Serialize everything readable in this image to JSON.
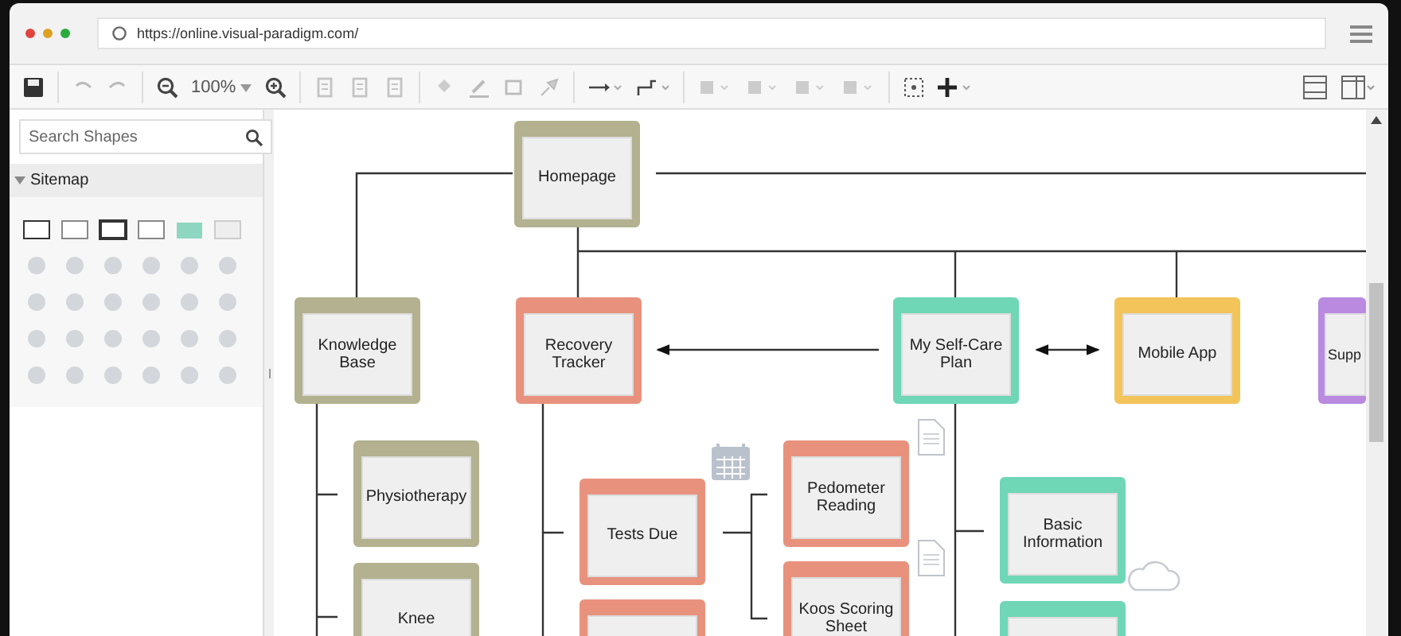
{
  "browser": {
    "url": "https://online.visual-paradigm.com/"
  },
  "toolbar": {
    "zoom": "100%"
  },
  "sidebar": {
    "search": {
      "placeholder": "Search Shapes"
    },
    "section": {
      "title": "Sitemap",
      "expanded": true
    }
  },
  "diagram": {
    "nodes": [
      {
        "label": "Homepage",
        "color": "#b3b18f"
      },
      {
        "label": "Knowledge Base",
        "color": "#b3b18f"
      },
      {
        "label": "Recovery Tracker",
        "color": "#e8927e"
      },
      {
        "label": "My Self-Care Plan",
        "color": "#6fd6b6"
      },
      {
        "label": "Mobile App",
        "color": "#f3c45a"
      },
      {
        "label": "Supp",
        "color": "#b98ae0"
      },
      {
        "label": "Physiotherapy",
        "color": "#b3b18f"
      },
      {
        "label": "Knee",
        "color": "#b3b18f"
      },
      {
        "label": "Tests Due",
        "color": "#e8927e"
      },
      {
        "color": "#e8927e"
      },
      {
        "label": "Pedometer Reading",
        "color": "#e8927e"
      },
      {
        "label": "Koos Scoring Sheet",
        "color": "#e8927e"
      },
      {
        "label": "Basic Information",
        "color": "#6fd6b6"
      },
      {
        "color": "#6fd6b6"
      }
    ]
  }
}
